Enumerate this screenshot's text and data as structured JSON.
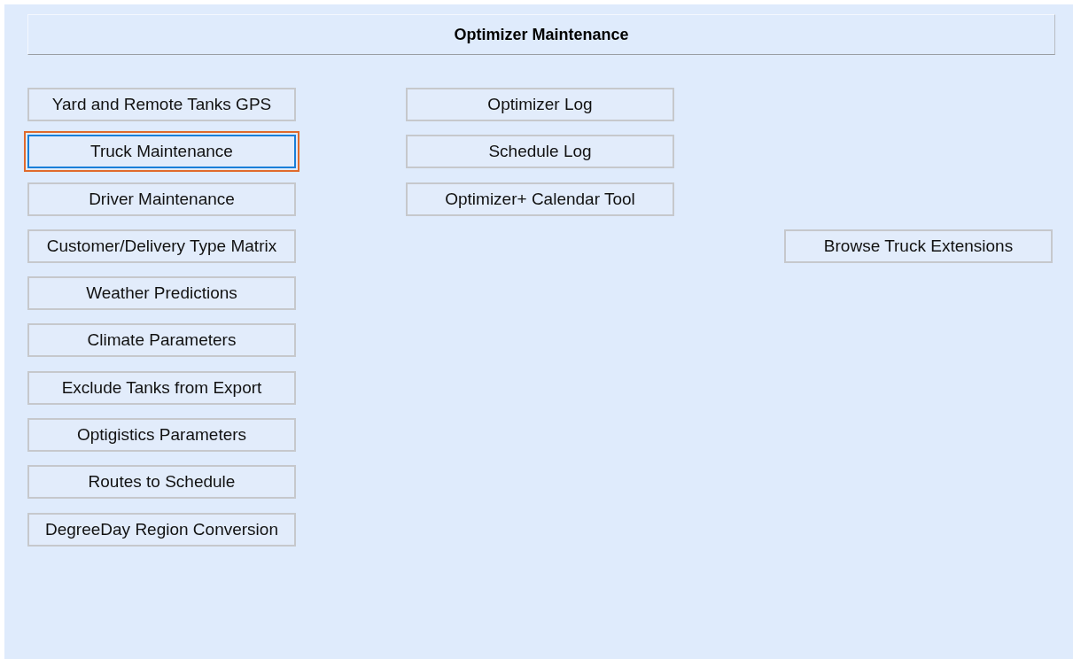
{
  "title": "Optimizer Maintenance",
  "rows": [
    {
      "left": {
        "label": "Yard and Remote Tanks GPS",
        "focused": false
      },
      "middle": {
        "label": "Optimizer Log",
        "focused": false
      }
    },
    {
      "left": {
        "label": "Truck Maintenance",
        "focused": true
      },
      "middle": {
        "label": "Schedule Log",
        "focused": false
      }
    },
    {
      "left": {
        "label": "Driver Maintenance",
        "focused": false
      },
      "middle": {
        "label": "Optimizer+ Calendar Tool",
        "focused": false
      }
    },
    {
      "left": {
        "label": "Customer/Delivery Type Matrix",
        "focused": false
      },
      "right": {
        "label": "Browse Truck Extensions",
        "focused": false
      }
    },
    {
      "left": {
        "label": "Weather Predictions",
        "focused": false
      }
    },
    {
      "left": {
        "label": "Climate Parameters",
        "focused": false
      }
    },
    {
      "left": {
        "label": "Exclude Tanks from Export",
        "focused": false
      }
    },
    {
      "left": {
        "label": "Optigistics Parameters",
        "focused": false
      }
    },
    {
      "left": {
        "label": "Routes to Schedule",
        "focused": false
      }
    },
    {
      "left": {
        "label": "DegreeDay Region Conversion",
        "focused": false
      }
    }
  ]
}
